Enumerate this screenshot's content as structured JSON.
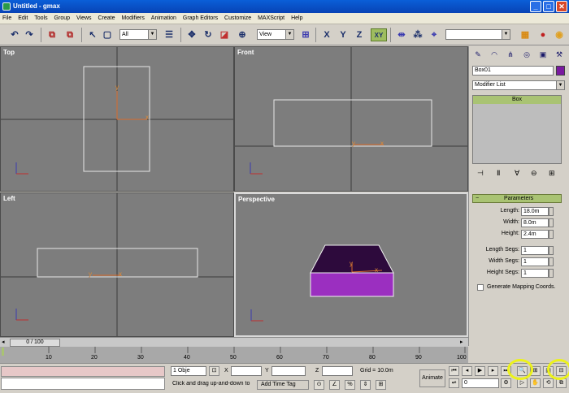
{
  "window": {
    "title": "Untitled - gmax",
    "minimize": "_",
    "maximize": "□",
    "close": "✕"
  },
  "menu": [
    "File",
    "Edit",
    "Tools",
    "Group",
    "Views",
    "Create",
    "Modifiers",
    "Animation",
    "Graph Editors",
    "Customize",
    "MAXScript",
    "Help"
  ],
  "toolbar": {
    "selection_filter": "All",
    "ref_coord": "View",
    "constraint_xy": "XY",
    "named_sel": ""
  },
  "viewports": [
    {
      "label": "Top"
    },
    {
      "label": "Front"
    },
    {
      "label": "Left"
    },
    {
      "label": "Perspective"
    }
  ],
  "axes": {
    "x": "x",
    "y": "y",
    "z": "z"
  },
  "command_panel": {
    "object_name": "Box01",
    "object_color": "#7a1aa0",
    "modifier_list": "Modifier List",
    "stack_items": [
      "Box"
    ],
    "rollout_title": "Parameters",
    "params": [
      {
        "label": "Length:",
        "value": "18.0m"
      },
      {
        "label": "Width:",
        "value": "8.0m"
      },
      {
        "label": "Height:",
        "value": "2.4m"
      },
      {
        "label": "Length Segs:",
        "value": "1"
      },
      {
        "label": "Width Segs:",
        "value": "1"
      },
      {
        "label": "Height Segs:",
        "value": "1"
      }
    ],
    "gen_mapping": "Generate Mapping Coords."
  },
  "timeline": {
    "slider": "0 / 100",
    "ticks": [
      "10",
      "20",
      "30",
      "40",
      "50",
      "60",
      "70",
      "80",
      "90",
      "100"
    ]
  },
  "status": {
    "selection": "1 Obje",
    "prompt": "Click and drag up-and-down to",
    "x_label": "X",
    "y_label": "Y",
    "z_label": "Z",
    "x_val": "",
    "y_val": "",
    "z_val": "",
    "grid": "Grid = 10.0m",
    "add_time_tag": "Add Time Tag",
    "animate": "Animate",
    "frame": "0"
  },
  "colors": {
    "viewport_bg": "#7d7d7d",
    "axis_x": "#d23a2a",
    "axis_y": "#e08a35",
    "box_color": "#9b2fc0",
    "highlight": "#ecf21a"
  }
}
